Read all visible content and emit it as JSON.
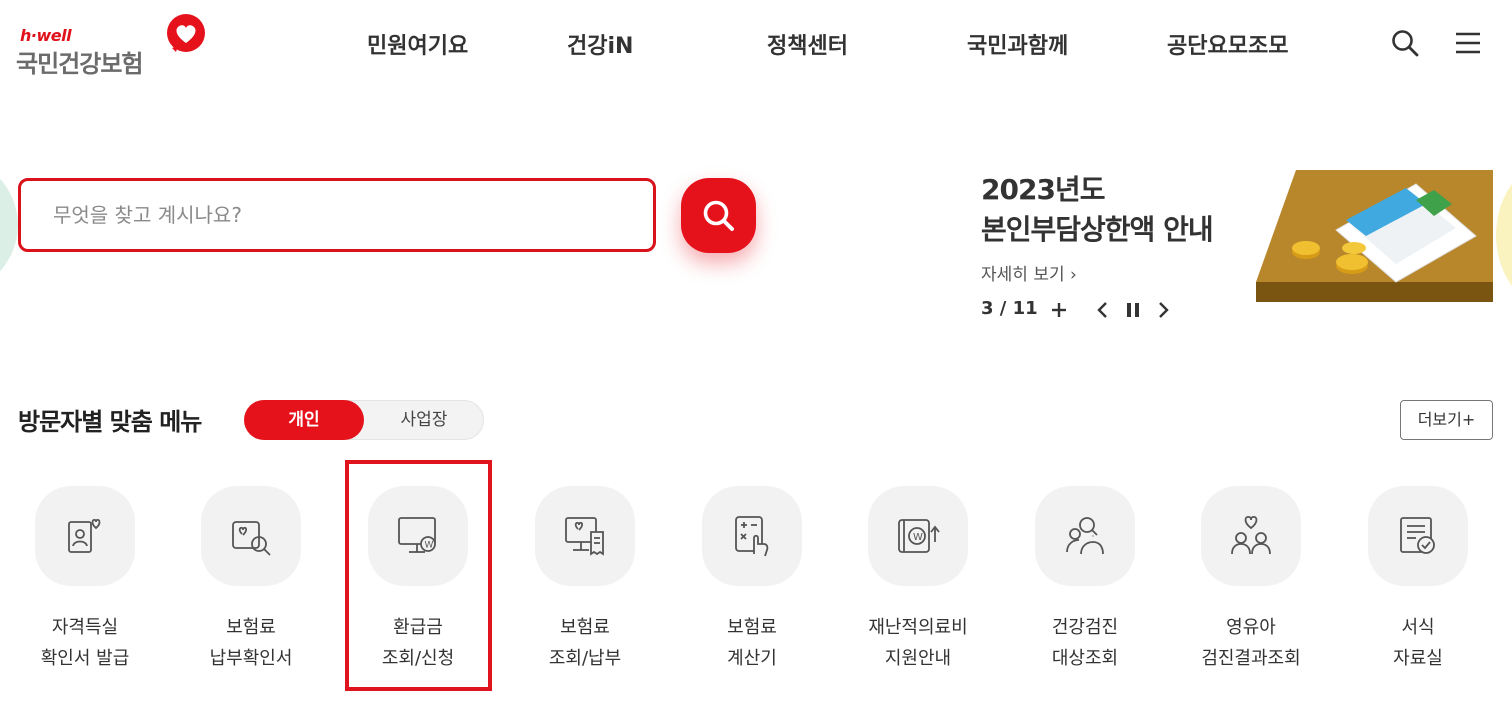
{
  "header": {
    "logo_sub": "h·well",
    "logo_main": "국민건강보험",
    "nav": [
      "민원여기요",
      "건강iN",
      "정책센터",
      "국민과함께",
      "공단요모조모"
    ],
    "search_icon": "search-icon",
    "menu_icon": "hamburger-menu-icon"
  },
  "search": {
    "placeholder": "무엇을 찾고 계시나요?",
    "value": "",
    "button_icon": "search-icon"
  },
  "banner": {
    "title_line1": "2023년도",
    "title_line2": "본인부담상한액 안내",
    "more": "자세히 보기 ›",
    "pager": "3 / 11",
    "add_icon": "plus-icon",
    "prev_icon": "chevron-left-icon",
    "pause_icon": "pause-icon",
    "next_icon": "chevron-right-icon",
    "image_icon": "calculator-coins-illustration"
  },
  "visitor_menu": {
    "title": "방문자별 맞춤 메뉴",
    "toggle_active": "개인",
    "toggle_inactive": "사업장",
    "more": "더보기+",
    "items": [
      {
        "line1": "자격득실",
        "line2": "확인서 발급",
        "icon": "id-card-heart-icon"
      },
      {
        "line1": "보험료",
        "line2": "납부확인서",
        "icon": "document-search-icon"
      },
      {
        "line1": "환급금",
        "line2": "조회/신청",
        "icon": "monitor-won-icon"
      },
      {
        "line1": "보험료",
        "line2": "조회/납부",
        "icon": "monitor-receipt-icon"
      },
      {
        "line1": "보험료",
        "line2": "계산기",
        "icon": "calculator-hand-icon"
      },
      {
        "line1": "재난적의료비",
        "line2": "지원안내",
        "icon": "wallet-won-icon"
      },
      {
        "line1": "건강검진",
        "line2": "대상조회",
        "icon": "people-search-icon"
      },
      {
        "line1": "영유아",
        "line2": "검진결과조회",
        "icon": "family-heart-icon"
      },
      {
        "line1": "서식",
        "line2": "자료실",
        "icon": "form-check-icon"
      }
    ]
  },
  "colors": {
    "brand_red": "#e5121c",
    "text_dark": "#333333"
  }
}
